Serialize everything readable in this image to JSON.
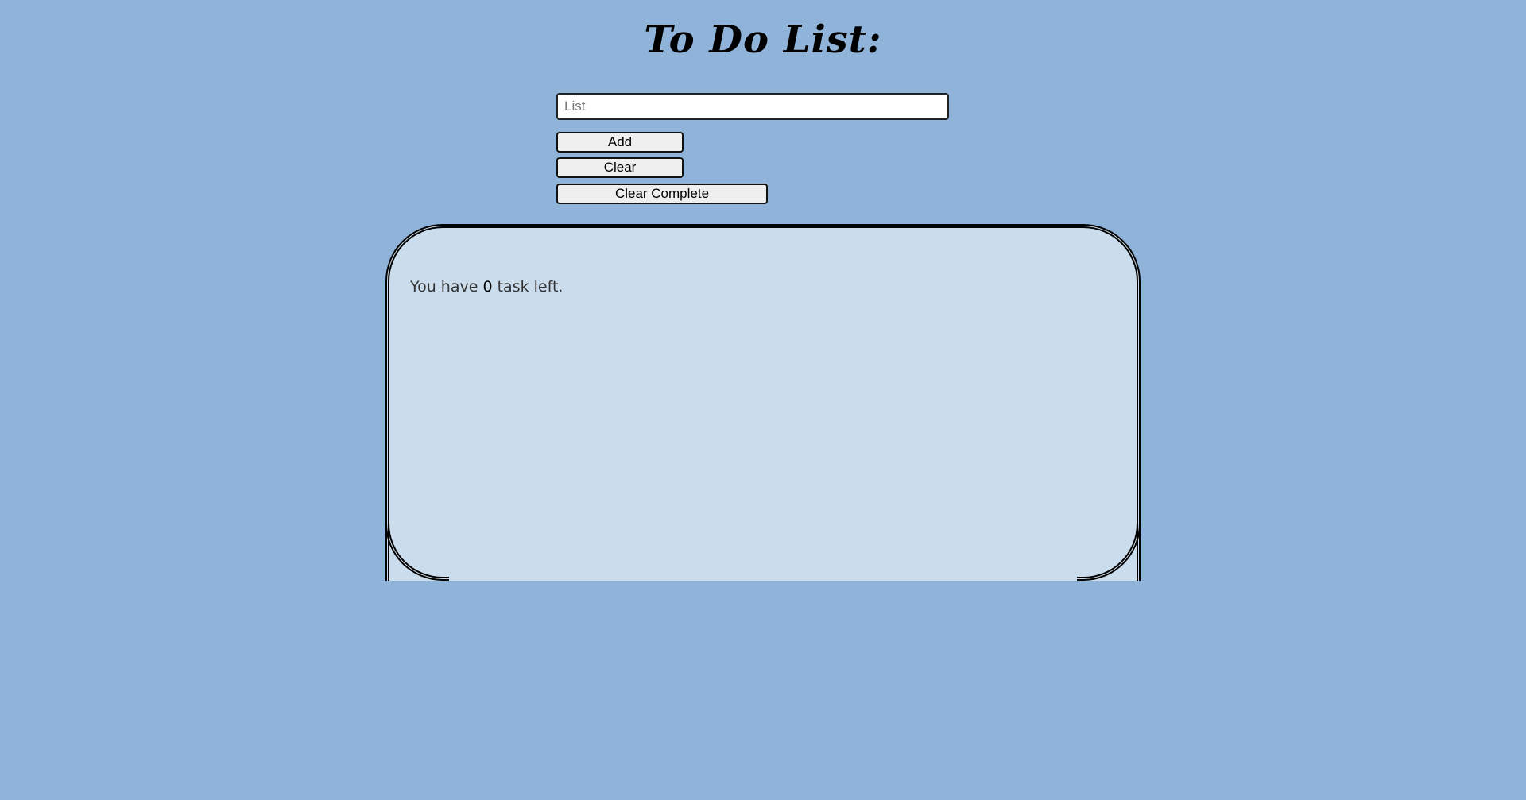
{
  "header": {
    "title": "To Do List:"
  },
  "form": {
    "input_placeholder": "List",
    "input_value": "",
    "add_label": "Add",
    "clear_label": "Clear",
    "clear_complete_label": "Clear Complete"
  },
  "tasks": {
    "count_prefix": "You have",
    "count": "0",
    "count_suffix": "task left.",
    "items": []
  },
  "colors": {
    "background": "#8fb3d9",
    "panel": "#cbdcec"
  }
}
